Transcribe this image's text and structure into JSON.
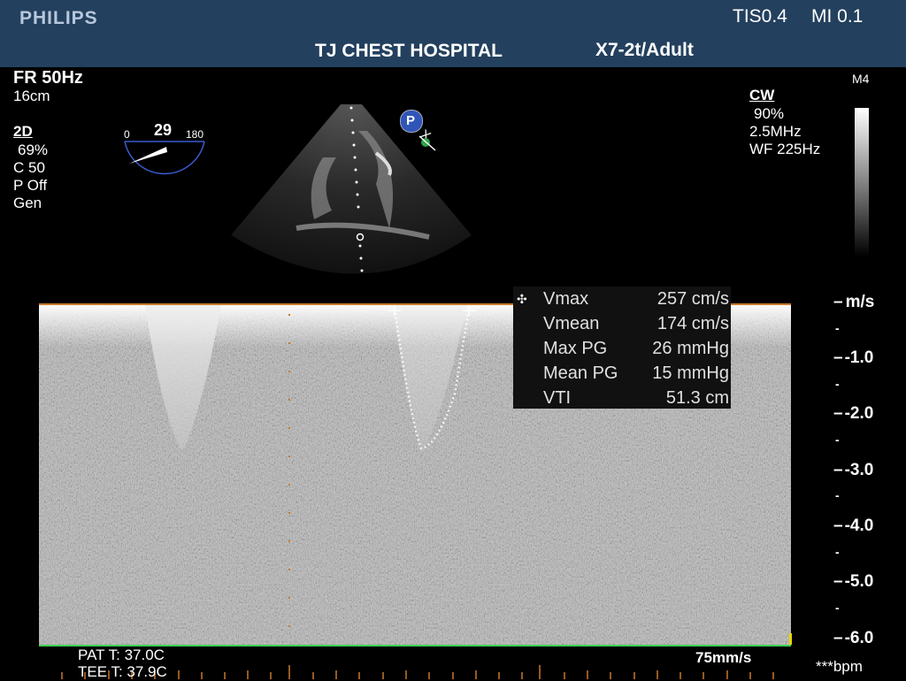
{
  "header": {
    "brand": "PHILIPS",
    "tis": "TIS0.4",
    "mi": "MI 0.1",
    "hospital": "TJ CHEST HOSPITAL",
    "probe": "X7-2t/Adult"
  },
  "left_panel": {
    "frame_rate": "FR 50Hz",
    "depth": "16cm",
    "mode": "2D",
    "gain": "69%",
    "compression": "C 50",
    "persistence": "P Off",
    "preset": "Gen"
  },
  "angle": {
    "min": "0",
    "value": "29",
    "max": "180"
  },
  "right_panel": {
    "map": "M4",
    "mode": "CW",
    "gain": "90%",
    "frequency": "2.5MHz",
    "wall_filter": "WF 225Hz"
  },
  "probe_marker": {
    "label": "P"
  },
  "measurements": [
    {
      "label": "Vmax",
      "value": "257 cm/s"
    },
    {
      "label": "Vmean",
      "value": "174 cm/s"
    },
    {
      "label": "Max PG",
      "value": "26 mmHg"
    },
    {
      "label": "Mean PG",
      "value": "15 mmHg"
    },
    {
      "label": "VTI",
      "value": "51.3 cm"
    }
  ],
  "velocity_scale": {
    "unit": "m/s",
    "labels": [
      "-1.0",
      "-2.0",
      "-3.0",
      "-4.0",
      "-5.0",
      "-6.0"
    ]
  },
  "footer": {
    "pat_temp": "PAT T: 37.0C",
    "tee_temp": "TEE T: 37.9C",
    "sweep": "75mm/s",
    "heart_rate": "***bpm"
  },
  "colors": {
    "header_bg": "#23405e",
    "baseline": "#c8782c",
    "ecg": "#3cd050"
  }
}
